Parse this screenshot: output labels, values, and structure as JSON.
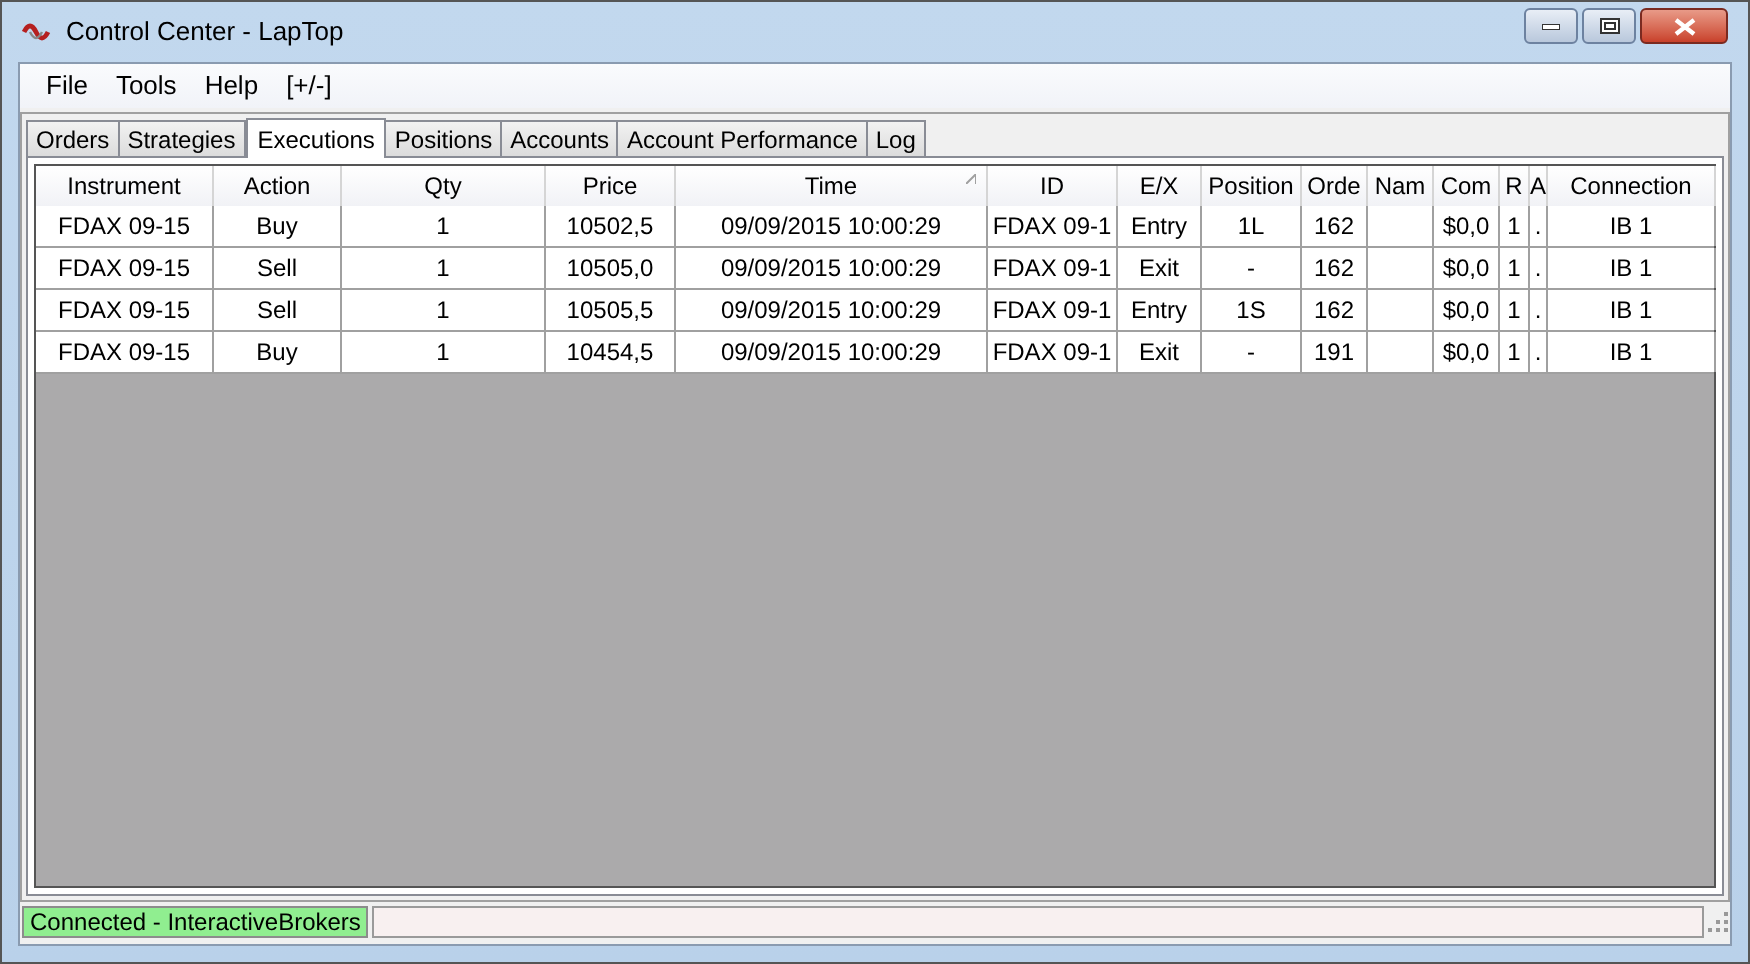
{
  "window": {
    "title": "Control Center - LapTop"
  },
  "menu": [
    "File",
    "Tools",
    "Help",
    "[+/-]"
  ],
  "tabs": [
    {
      "label": "Orders",
      "selected": false
    },
    {
      "label": "Strategies",
      "selected": false
    },
    {
      "label": "Executions",
      "selected": true
    },
    {
      "label": "Positions",
      "selected": false
    },
    {
      "label": "Accounts",
      "selected": false
    },
    {
      "label": "Account Performance",
      "selected": false
    },
    {
      "label": "Log",
      "selected": false
    }
  ],
  "table": {
    "columns": [
      {
        "label": "Instrument",
        "sorted": false
      },
      {
        "label": "Action",
        "sorted": false
      },
      {
        "label": "Qty",
        "sorted": false
      },
      {
        "label": "Price",
        "sorted": false
      },
      {
        "label": "Time",
        "sorted": true
      },
      {
        "label": "ID",
        "sorted": false
      },
      {
        "label": "E/X",
        "sorted": false
      },
      {
        "label": "Position",
        "sorted": false
      },
      {
        "label": "Orde",
        "sorted": false
      },
      {
        "label": "Nam",
        "sorted": false
      },
      {
        "label": "Com",
        "sorted": false
      },
      {
        "label": "R",
        "sorted": false
      },
      {
        "label": "A",
        "sorted": false
      },
      {
        "label": "Connection",
        "sorted": false
      }
    ],
    "rows": [
      [
        "FDAX 09-15",
        "Buy",
        "1",
        "10502,5",
        "09/09/2015 10:00:29",
        "FDAX 09-1",
        "Entry",
        "1L",
        "162",
        "",
        "$0,0",
        "1",
        ".",
        "IB 1"
      ],
      [
        "FDAX 09-15",
        "Sell",
        "1",
        "10505,0",
        "09/09/2015 10:00:29",
        "FDAX 09-1",
        "Exit",
        "-",
        "162",
        "",
        "$0,0",
        "1",
        ".",
        "IB 1"
      ],
      [
        "FDAX 09-15",
        "Sell",
        "1",
        "10505,5",
        "09/09/2015 10:00:29",
        "FDAX 09-1",
        "Entry",
        "1S",
        "162",
        "",
        "$0,0",
        "1",
        ".",
        "IB 1"
      ],
      [
        "FDAX 09-15",
        "Buy",
        "1",
        "10454,5",
        "09/09/2015 10:00:29",
        "FDAX 09-1",
        "Exit",
        "-",
        "191",
        "",
        "$0,0",
        "1",
        ".",
        "IB 1"
      ]
    ]
  },
  "status_bar": {
    "connection": "Connected - InteractiveBrokers",
    "connected": true
  }
}
